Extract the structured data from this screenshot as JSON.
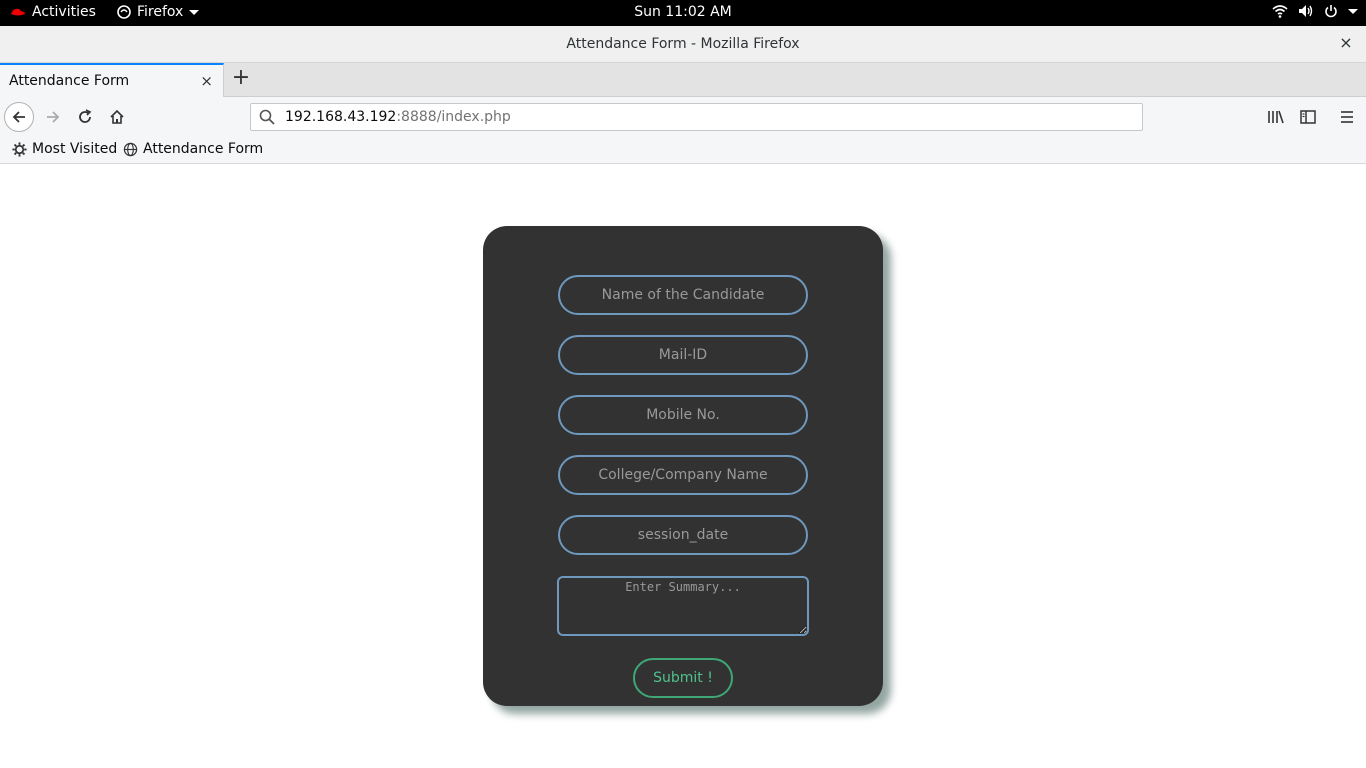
{
  "topbar": {
    "activities": "Activities",
    "app_menu": "Firefox",
    "clock": "Sun 11:02 AM"
  },
  "window": {
    "title": "Attendance Form - Mozilla Firefox",
    "close": "×"
  },
  "tab": {
    "label": "Attendance Form",
    "close": "×",
    "new_tab": "+"
  },
  "url": {
    "host": "192.168.43.192",
    "rest": ":8888/index.php"
  },
  "bookmarks": {
    "most_visited": "Most Visited",
    "attendance_form": "Attendance Form"
  },
  "form": {
    "name_placeholder": "Name of the Candidate",
    "mail_placeholder": "Mail-ID",
    "mobile_placeholder": "Mobile No.",
    "college_placeholder": "College/Company Name",
    "session_placeholder": "session_date",
    "summary_placeholder": "Enter Summary...",
    "submit_label": "Submit !"
  },
  "colors": {
    "card_bg": "#323232",
    "field_border": "#6e98bd",
    "submit_border": "#3ea677",
    "submit_text": "#4fc28c",
    "tab_accent": "#0a84ff"
  }
}
